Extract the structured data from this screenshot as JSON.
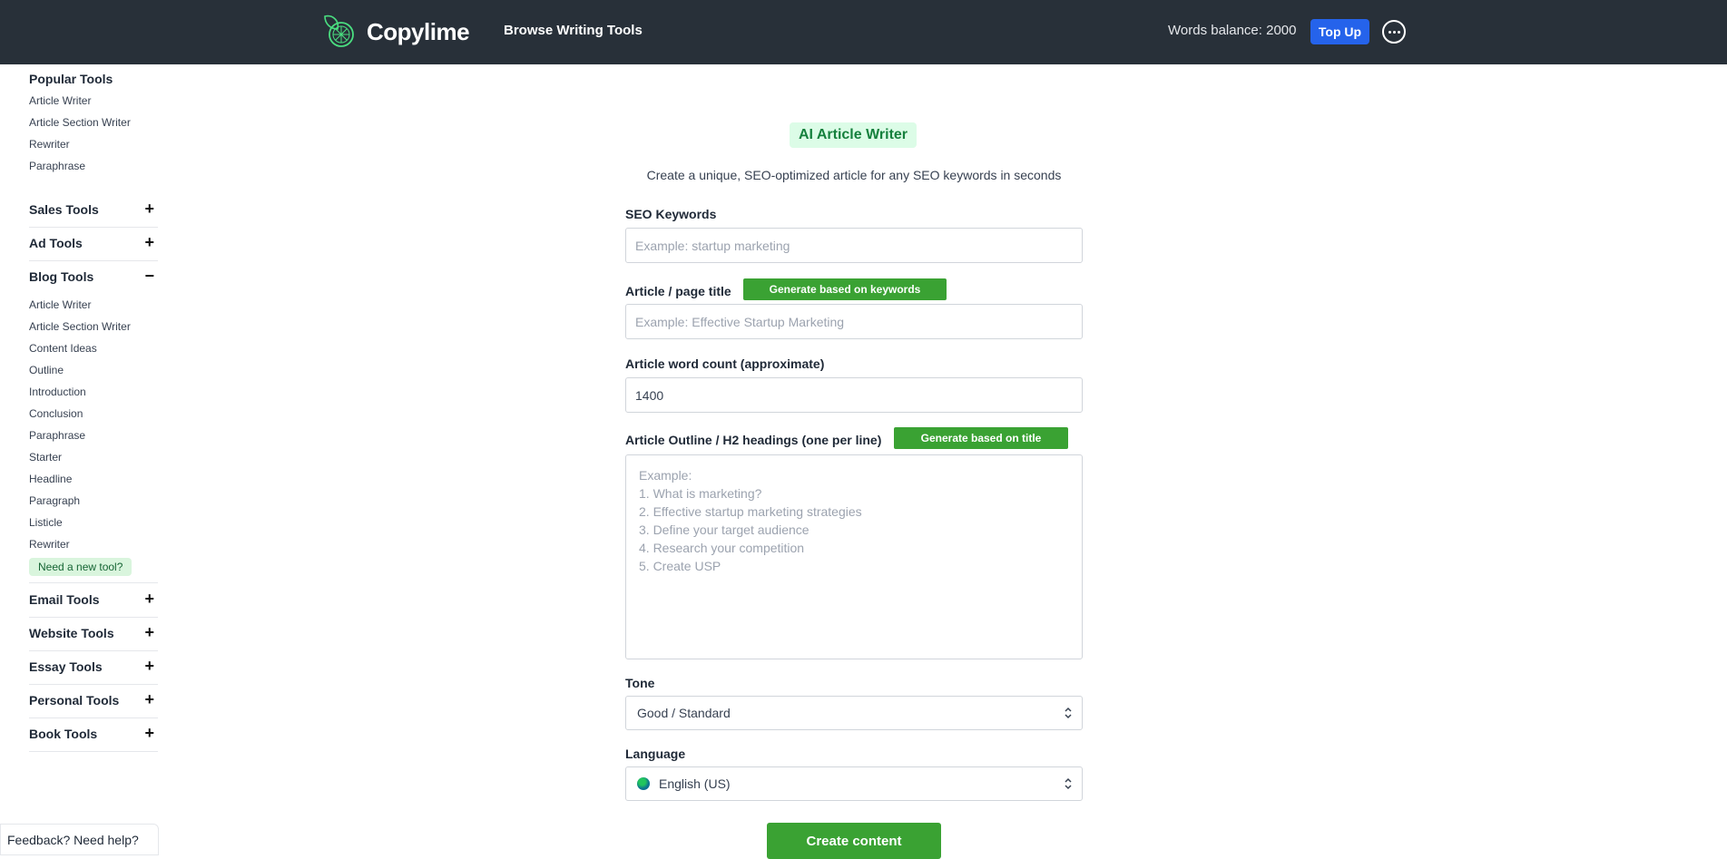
{
  "header": {
    "logo_text": "Copylime",
    "browse_label": "Browse Writing Tools",
    "balance_text": "Words balance: 2000",
    "topup_label": "Top Up",
    "more_icon": "more-options-icon"
  },
  "sidebar": {
    "popular_title": "Popular Tools",
    "popular_items": [
      "Article Writer",
      "Article Section Writer",
      "Rewriter",
      "Paraphrase"
    ],
    "categories": [
      {
        "label": "Sales Tools",
        "toggle": "+"
      },
      {
        "label": "Ad Tools",
        "toggle": "+"
      },
      {
        "label": "Blog Tools",
        "toggle": "−"
      },
      {
        "label": "Email Tools",
        "toggle": "+"
      },
      {
        "label": "Website Tools",
        "toggle": "+"
      },
      {
        "label": "Essay Tools",
        "toggle": "+"
      },
      {
        "label": "Personal Tools",
        "toggle": "+"
      },
      {
        "label": "Book Tools",
        "toggle": "+"
      }
    ],
    "blog_items": [
      "Article Writer",
      "Article Section Writer",
      "Content Ideas",
      "Outline",
      "Introduction",
      "Conclusion",
      "Paraphrase",
      "Starter",
      "Headline",
      "Paragraph",
      "Listicle",
      "Rewriter"
    ],
    "need_tool": "Need a new tool?"
  },
  "feedback": "Feedback? Need help?",
  "form": {
    "badge": "AI Article Writer",
    "subtitle": "Create a unique, SEO-optimized article for any SEO keywords in seconds",
    "keywords_label": "SEO Keywords",
    "keywords_placeholder": "Example: startup marketing",
    "title_label": "Article / page title",
    "title_gen_button": "Generate based on keywords",
    "title_placeholder": "Example: Effective Startup Marketing",
    "wordcount_label": "Article word count (approximate)",
    "wordcount_value": "1400",
    "outline_label": "Article Outline / H2 headings (one per line)",
    "outline_gen_button": "Generate based on title",
    "outline_placeholder": "Example:\n1. What is marketing?\n2. Effective startup marketing strategies\n3. Define your target audience\n4. Research your competition\n5. Create USP",
    "tone_label": "Tone",
    "tone_value": "Good / Standard",
    "language_label": "Language",
    "language_value": "English (US)",
    "create_button": "Create content"
  },
  "colors": {
    "header_bg": "#283039",
    "accent_green": "#3aa233",
    "topup_blue": "#2563eb",
    "badge_bg": "#dcfce7"
  }
}
